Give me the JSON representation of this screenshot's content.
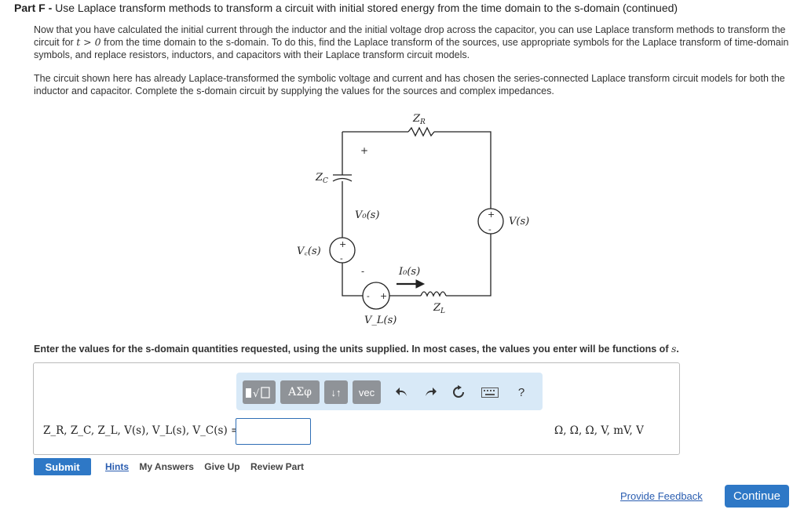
{
  "header": {
    "part_label": "Part F",
    "separator": " - ",
    "title": "Use Laplace transform methods to transform a circuit with initial stored energy from the time domain to the s-domain (continued)"
  },
  "intro": {
    "p1_a": "Now that you have calculated the initial current through the inductor and the initial voltage drop across the capacitor, you can use Laplace transform methods to transform the circuit for ",
    "p1_math": "t > 0",
    "p1_b": " from the time domain to the s-domain. To do this, find the Laplace transform of the sources, use appropriate symbols for the Laplace transform of time-domain symbols, and replace resistors, inductors, and capacitors with their Laplace transform circuit models.",
    "p2": "The circuit shown here has already Laplace-transformed the symbolic voltage and current and has chosen the series-connected Laplace transform circuit models for both the inductor and capacitor. Complete the s-domain circuit by supplying the values for the sources and complex impedances."
  },
  "circuit": {
    "zr_label": "Z",
    "zr_sub": "R",
    "zc_label": "Z",
    "zc_sub": "C",
    "zl_label": "Z",
    "zl_sub": "L",
    "v0_label": "V₀(s)",
    "vs_label": "V(s)",
    "vc_label": "V꜀(s)",
    "i0_label": "I₀(s)",
    "vl_label": "V_L(s)",
    "plus": "+",
    "minus": "-"
  },
  "instructions": {
    "text": "Enter the values for the s-domain quantities requested, using the units supplied. In most cases, the values you enter will be functions of ",
    "var": "s",
    "end": "."
  },
  "toolbar": {
    "templates_icon": "templates-icon",
    "greek_label": "ΑΣφ",
    "arrows_label": "↓↑",
    "vec_label": "vec",
    "undo_icon": "undo-icon",
    "redo_icon": "redo-icon",
    "reset_icon": "reset-icon",
    "keyboard_icon": "keyboard-icon",
    "help_label": "?"
  },
  "answer": {
    "label": "Z_R, Z_C, Z_L, V(s), V_L(s), V_C(s) =",
    "value": "",
    "units": "Ω, Ω, Ω, V, mV, V"
  },
  "actions": {
    "submit": "Submit",
    "hints": "Hints",
    "my_answers": "My Answers",
    "give_up": "Give Up",
    "review_part": "Review Part",
    "feedback": "Provide Feedback",
    "continue": "Continue"
  },
  "colors": {
    "accent": "#2e78c6",
    "toolbar_bg": "#d8e9f7",
    "link": "#2a5db0"
  }
}
